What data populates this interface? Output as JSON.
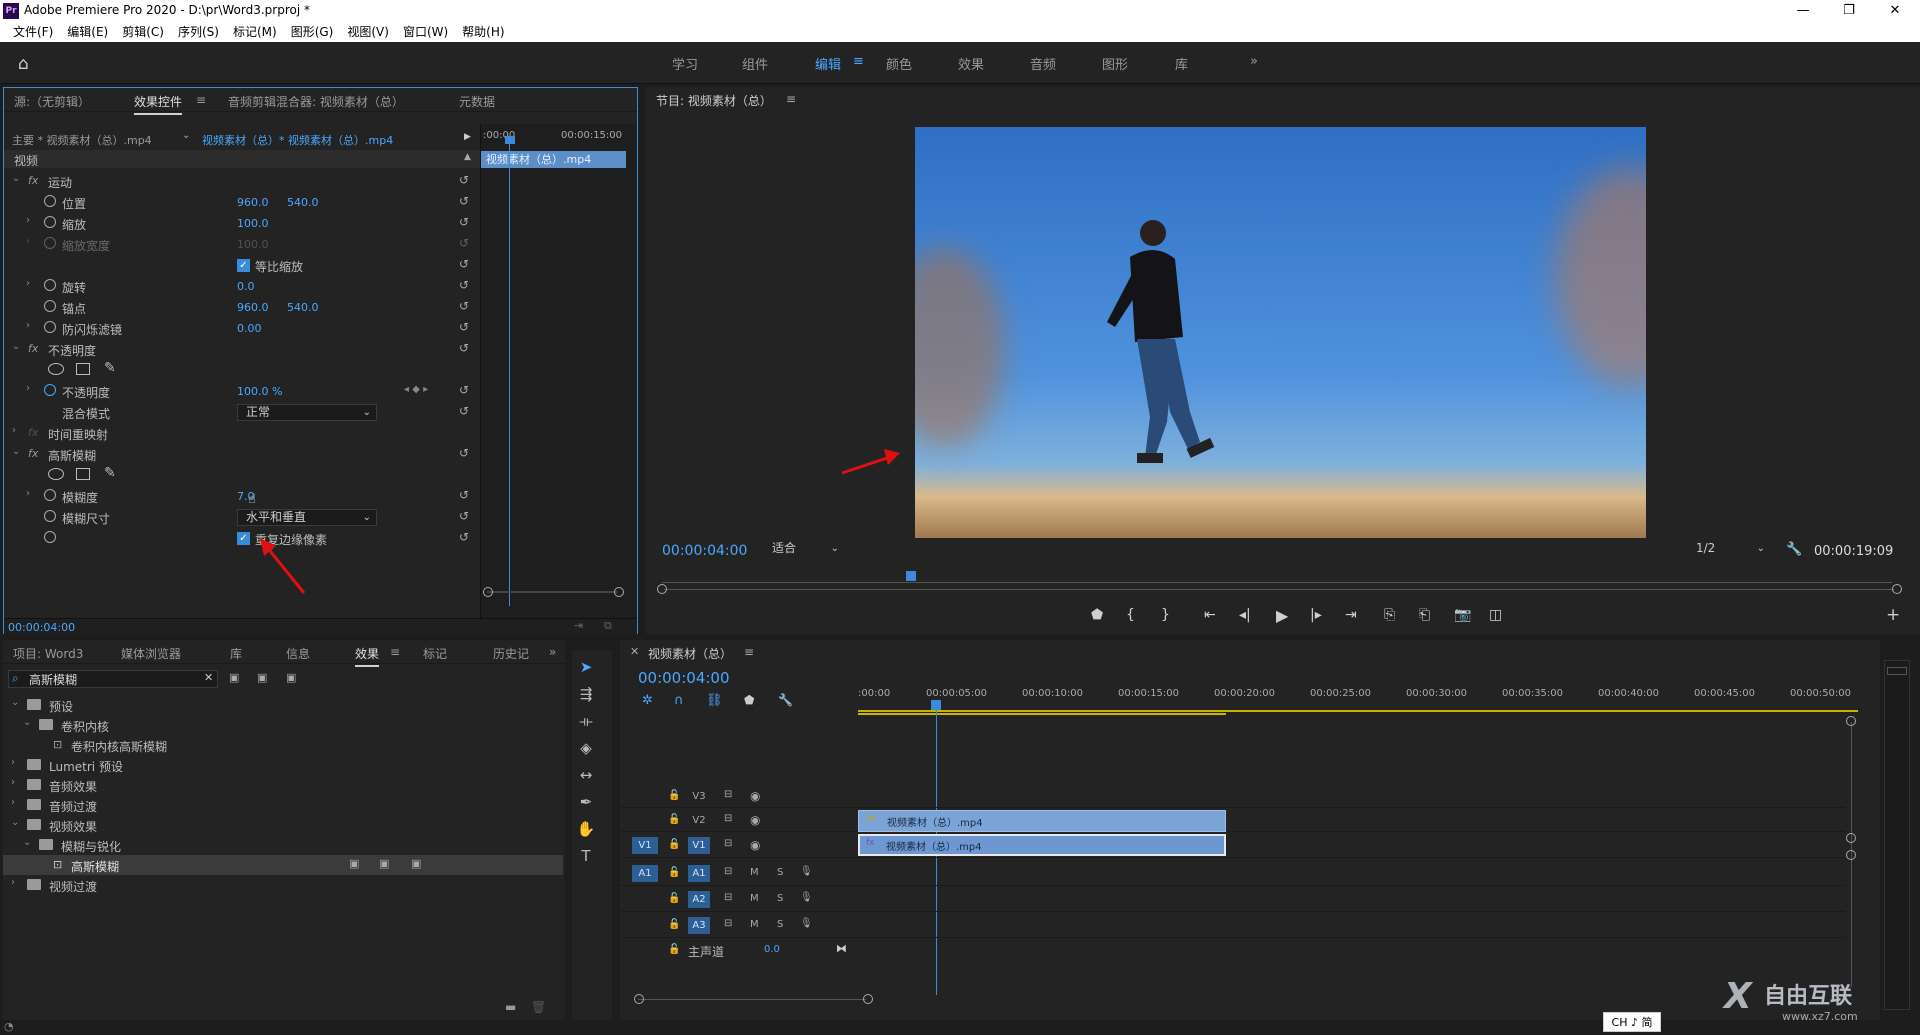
{
  "window": {
    "title": "Adobe Premiere Pro 2020 - D:\\pr\\Word3.prproj *",
    "logo": "Pr"
  },
  "menu": [
    "文件(F)",
    "编辑(E)",
    "剪辑(C)",
    "序列(S)",
    "标记(M)",
    "图形(G)",
    "视图(V)",
    "窗口(W)",
    "帮助(H)"
  ],
  "workspaces": [
    "学习",
    "组件",
    "编辑",
    "颜色",
    "效果",
    "音频",
    "图形",
    "库"
  ],
  "workspace_active": "编辑",
  "effects_panel": {
    "tabs": [
      "源:（无剪辑）",
      "效果控件",
      "音频剪辑混合器: 视频素材（总）",
      "元数据"
    ],
    "active_tab": "效果控件",
    "master": "主要 * 视频素材（总）.mp4",
    "clip": "视频素材（总）* 视频素材（总）.mp4",
    "mini_start": ":00:00",
    "mini_end": "00:00:15:00",
    "mini_clip": "视频素材（总）.mp4",
    "section_video": "视频",
    "motion": "运动",
    "position": "位置",
    "position_x": "960.0",
    "position_y": "540.0",
    "scale": "缩放",
    "scale_v": "100.0",
    "scale_width": "缩放宽度",
    "scale_width_v": "100.0",
    "uniform": "等比缩放",
    "rotation": "旋转",
    "rotation_v": "0.0",
    "anchor": "锚点",
    "anchor_x": "960.0",
    "anchor_y": "540.0",
    "flicker": "防闪烁滤镜",
    "flicker_v": "0.00",
    "opacity": "不透明度",
    "opacity_prop": "不透明度",
    "opacity_v": "100.0 %",
    "blend": "混合模式",
    "blend_v": "正常",
    "time_remap": "时间重映射",
    "gauss": "高斯模糊",
    "blurriness": "模糊度",
    "blurriness_v": "7.0",
    "blur_dim": "模糊尺寸",
    "blur_dim_v": "水平和垂直",
    "repeat_edge": "重复边缘像素",
    "timecode": "00:00:04:00"
  },
  "program": {
    "title": "节目: 视频素材（总）",
    "timecode": "00:00:04:00",
    "fit": "适合",
    "quality": "1/2",
    "duration": "00:00:19:09"
  },
  "project": {
    "tabs": [
      "项目: Word3",
      "媒体浏览器",
      "库",
      "信息",
      "效果",
      "标记",
      "历史记"
    ],
    "active_tab": "效果",
    "search": "高斯模糊",
    "tree": [
      "预设",
      "卷积内核",
      "卷积内核高斯模糊",
      "Lumetri 预设",
      "音频效果",
      "音频过渡",
      "视频效果",
      "模糊与锐化",
      "高斯模糊",
      "视频过渡"
    ]
  },
  "timeline": {
    "title": "视频素材（总）",
    "timecode": "00:00:04:00",
    "ruler": [
      ":00:00",
      "00:00:05:00",
      "00:00:10:00",
      "00:00:15:00",
      "00:00:20:00",
      "00:00:25:00",
      "00:00:30:00",
      "00:00:35:00",
      "00:00:40:00",
      "00:00:45:00",
      "00:00:50:00"
    ],
    "tracks": [
      "V3",
      "V2",
      "V1",
      "A1",
      "A2",
      "A3"
    ],
    "src_v": "V1",
    "src_a": "A1",
    "m": "M",
    "s": "S",
    "master": "主声道",
    "master_v": "0.0",
    "clip_v2": "视频素材（总）.mp4",
    "clip_v1": "视频素材（总）.mp4"
  },
  "taskbar": {
    "ime": "CH ♪ 简"
  },
  "watermark": {
    "text": "自由互联",
    "url": "www.xz7.com"
  },
  "colors": {
    "accent": "#4aa8ff",
    "panel": "#232323",
    "clip": "#7aa3d6"
  }
}
